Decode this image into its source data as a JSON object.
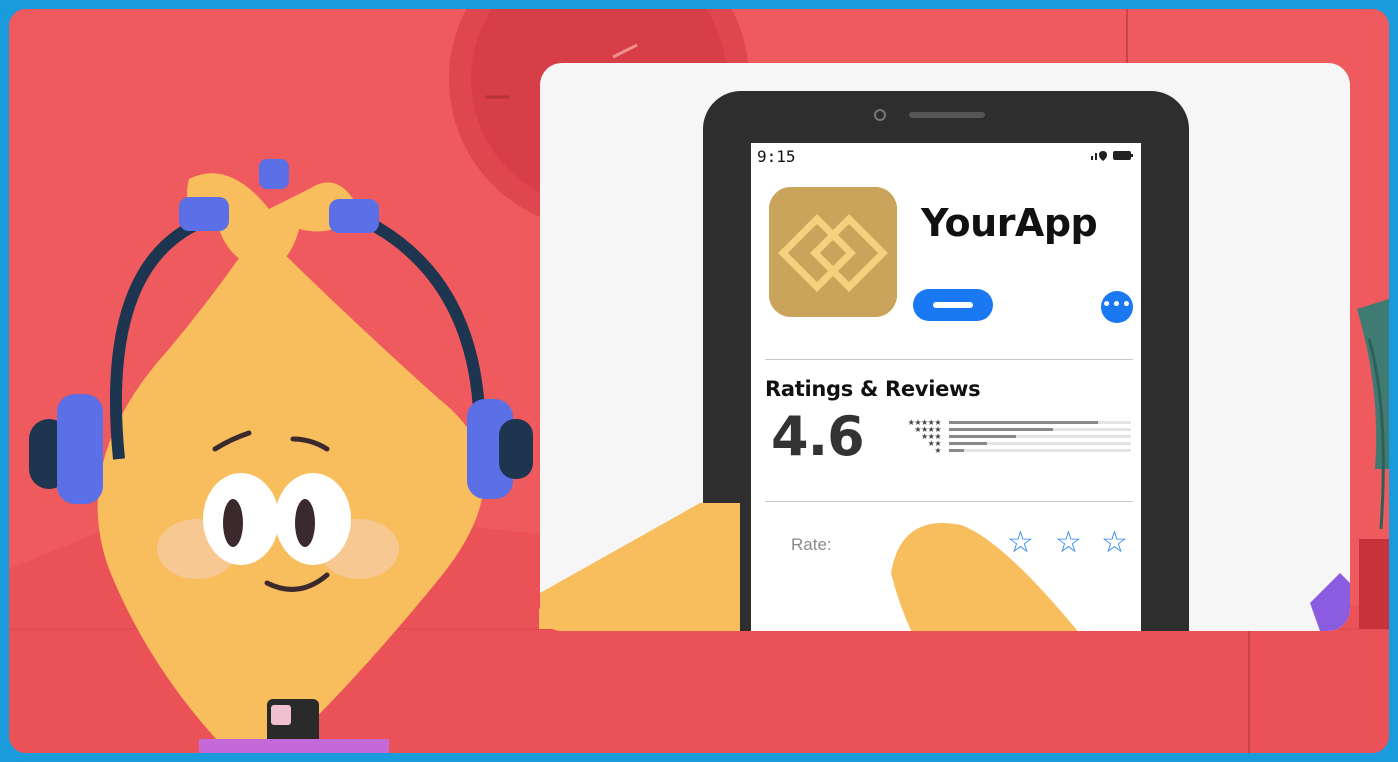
{
  "phone": {
    "status_time": "9:15"
  },
  "app": {
    "name": "YourApp"
  },
  "ratings": {
    "section_title": "Ratings & Reviews",
    "average": "4.6",
    "star_rows": [
      "★★★★★",
      "★★★★",
      "★★★",
      "★★",
      "★"
    ],
    "distribution": [
      0.82,
      0.57,
      0.37,
      0.21,
      0.08
    ]
  },
  "rate": {
    "label": "Rate:",
    "star_glyph": "☆"
  },
  "colors": {
    "background": "#ee5a5e",
    "frame": "#1a9bdc",
    "accent_blue": "#1a78f2",
    "app_icon_gold": "#c9a45a",
    "character_yellow": "#f8bd5c",
    "headphone_purple": "#5b6fe6"
  }
}
